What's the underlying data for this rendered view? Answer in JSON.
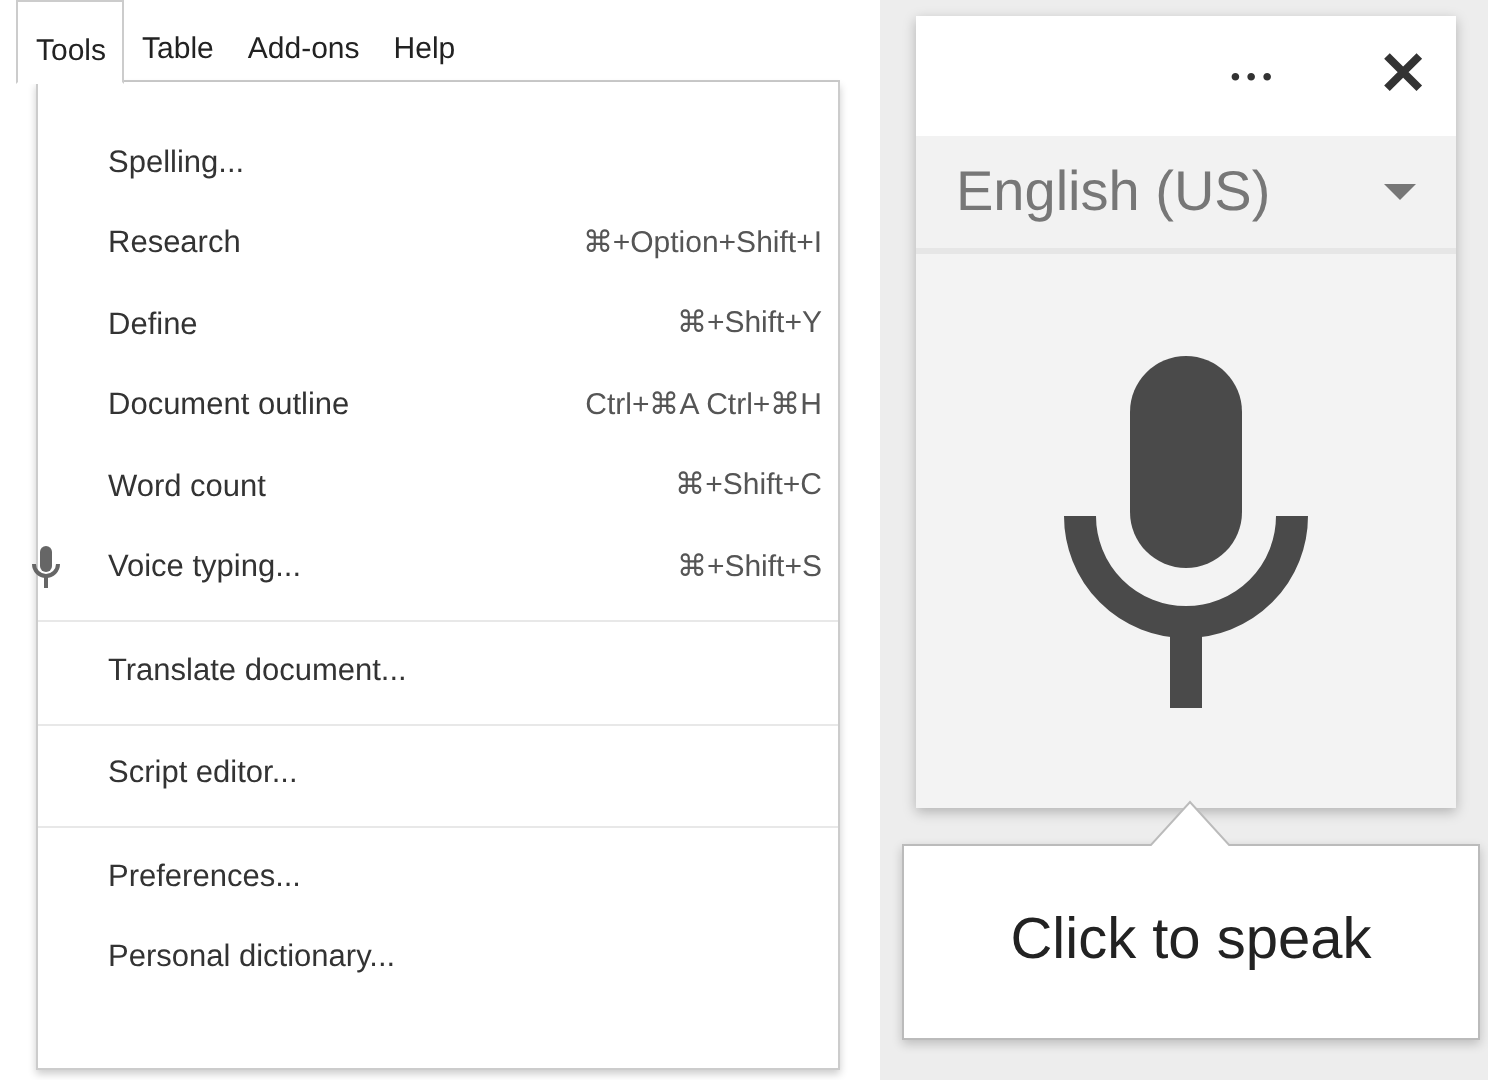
{
  "menubar": [
    {
      "label": "Tools",
      "selected": true
    },
    {
      "label": "Table",
      "selected": false
    },
    {
      "label": "Add-ons",
      "selected": false
    },
    {
      "label": "Help",
      "selected": false
    }
  ],
  "menu_groups": [
    [
      {
        "label": "Spelling...",
        "kind": "plain"
      },
      {
        "label": "Research",
        "shortcut": "⌘+Option+Shift+I",
        "kind": "plain"
      },
      {
        "label": "Define",
        "shortcut": "⌘+Shift+Y",
        "kind": "plain"
      },
      {
        "label": "Document outline",
        "shortcut": "Ctrl+⌘A Ctrl+⌘H",
        "kind": "plain"
      },
      {
        "label": "Word count",
        "shortcut": "⌘+Shift+C",
        "kind": "plain"
      },
      {
        "label": "Voice typing...",
        "shortcut": "⌘+Shift+S",
        "kind": "mic"
      }
    ],
    [
      {
        "label": "Translate document...",
        "kind": "plain"
      }
    ],
    [
      {
        "label": "Script editor...",
        "kind": "plain"
      }
    ],
    [
      {
        "label": "Preferences...",
        "kind": "plain"
      },
      {
        "label": "Personal dictionary...",
        "kind": "plain"
      }
    ]
  ],
  "voice_panel": {
    "more": "•••",
    "close": "✕",
    "language": "English (US)",
    "tooltip": "Click to speak"
  }
}
